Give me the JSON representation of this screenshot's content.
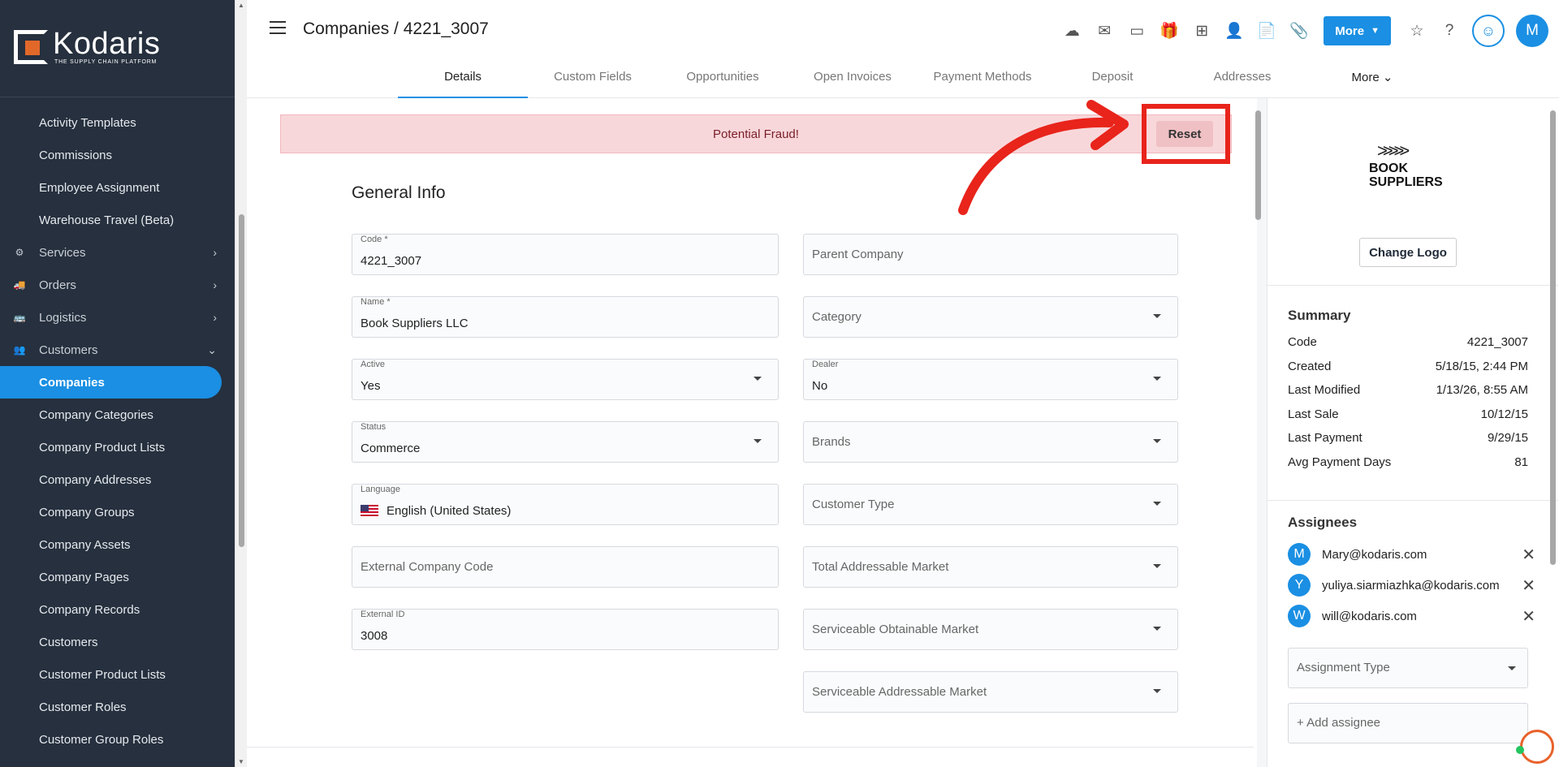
{
  "brand": {
    "name": "Kodaris",
    "tagline": "THE SUPPLY CHAIN PLATFORM"
  },
  "sidebar": {
    "items": [
      {
        "label": "Activity Templates",
        "type": "item"
      },
      {
        "label": "Commissions",
        "type": "item"
      },
      {
        "label": "Employee Assignment",
        "type": "item"
      },
      {
        "label": "Warehouse Travel (Beta)",
        "type": "item"
      },
      {
        "label": "Services",
        "type": "group",
        "icon": "gears-icon"
      },
      {
        "label": "Orders",
        "type": "group",
        "icon": "truck-icon"
      },
      {
        "label": "Logistics",
        "type": "group",
        "icon": "bus-icon"
      },
      {
        "label": "Customers",
        "type": "group",
        "icon": "people-icon"
      },
      {
        "label": "Companies",
        "type": "item",
        "active": true
      },
      {
        "label": "Company Categories",
        "type": "item"
      },
      {
        "label": "Company Product Lists",
        "type": "item"
      },
      {
        "label": "Company Addresses",
        "type": "item"
      },
      {
        "label": "Company Groups",
        "type": "item"
      },
      {
        "label": "Company Assets",
        "type": "item"
      },
      {
        "label": "Company Pages",
        "type": "item"
      },
      {
        "label": "Company Records",
        "type": "item"
      },
      {
        "label": "Customers",
        "type": "item"
      },
      {
        "label": "Customer Product Lists",
        "type": "item"
      },
      {
        "label": "Customer Roles",
        "type": "item"
      },
      {
        "label": "Customer Group Roles",
        "type": "item"
      }
    ]
  },
  "header": {
    "title": "Companies / 4221_3007",
    "more_label": "More",
    "avatar_initial": "M"
  },
  "tabs": [
    "Details",
    "Custom Fields",
    "Opportunities",
    "Open Invoices",
    "Payment Methods",
    "Deposit",
    "Addresses",
    "More"
  ],
  "banner": {
    "text": "Potential Fraud!",
    "reset_label": "Reset"
  },
  "general_info": {
    "title": "General Info",
    "left_fields": [
      {
        "label": "Code *",
        "value": "4221_3007"
      },
      {
        "label": "Name *",
        "value": "Book Suppliers LLC"
      },
      {
        "label": "Active",
        "value": "Yes",
        "dropdown": true
      },
      {
        "label": "Status",
        "value": "Commerce",
        "dropdown": true
      },
      {
        "label": "Language",
        "value": "English (United States)",
        "flag": true
      },
      {
        "placeholder": "External Company Code"
      },
      {
        "label": "External ID",
        "value": "3008"
      }
    ],
    "right_fields": [
      {
        "placeholder": "Parent Company"
      },
      {
        "placeholder": "Category",
        "dropdown": true
      },
      {
        "label": "Dealer",
        "value": "No",
        "dropdown": true
      },
      {
        "placeholder": "Brands",
        "dropdown": true
      },
      {
        "placeholder": "Customer Type",
        "dropdown": true
      },
      {
        "placeholder": "Total Addressable Market",
        "dropdown": true
      },
      {
        "placeholder": "Serviceable Obtainable Market",
        "dropdown": true
      },
      {
        "placeholder": "Serviceable Addressable Market",
        "dropdown": true
      }
    ]
  },
  "right_panel": {
    "logo_text_line1": "BOOK",
    "logo_text_line2": "SUPPLIERS",
    "change_logo_label": "Change Logo",
    "summary_title": "Summary",
    "summary": [
      {
        "label": "Code",
        "value": "4221_3007"
      },
      {
        "label": "Created",
        "value": "5/18/15, 2:44 PM"
      },
      {
        "label": "Last Modified",
        "value": "1/13/26, 8:55 AM"
      },
      {
        "label": "Last Sale",
        "value": "10/12/15"
      },
      {
        "label": "Last Payment",
        "value": "9/29/15"
      },
      {
        "label": "Avg Payment Days",
        "value": "81"
      }
    ],
    "assignees_title": "Assignees",
    "assignees": [
      {
        "initial": "M",
        "email": "Mary@kodaris.com"
      },
      {
        "initial": "Y",
        "email": "yuliya.siarmiazhka@kodaris.com"
      },
      {
        "initial": "W",
        "email": "will@kodaris.com"
      }
    ],
    "assignment_type_placeholder": "Assignment Type",
    "add_assignee_placeholder": "+ Add assignee"
  },
  "colors": {
    "accent": "#1a8fe3",
    "sidebar_bg": "#26303e",
    "fraud_bg": "#f8d7da",
    "highlight": "#e8241b"
  }
}
